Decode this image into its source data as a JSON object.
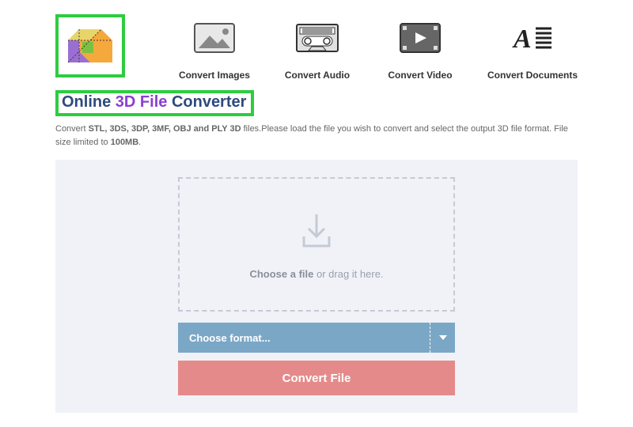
{
  "nav": {
    "images": "Convert Images",
    "audio": "Convert Audio",
    "video": "Convert Video",
    "documents": "Convert Documents"
  },
  "title": {
    "part1": "Online",
    "part2": "3D File",
    "part3": "Converter"
  },
  "desc": {
    "prefix": "Convert ",
    "formats": "STL, 3DS, 3DP, 3MF, OBJ and PLY 3D",
    "middle": " files.Please load the file you wish to convert and select the output 3D file format. File size limited to ",
    "limit": "100MB",
    "suffix": "."
  },
  "dropzone": {
    "bold": "Choose a file",
    "rest": " or drag it here."
  },
  "format_select": {
    "label": "Choose format..."
  },
  "convert_button": "Convert File"
}
